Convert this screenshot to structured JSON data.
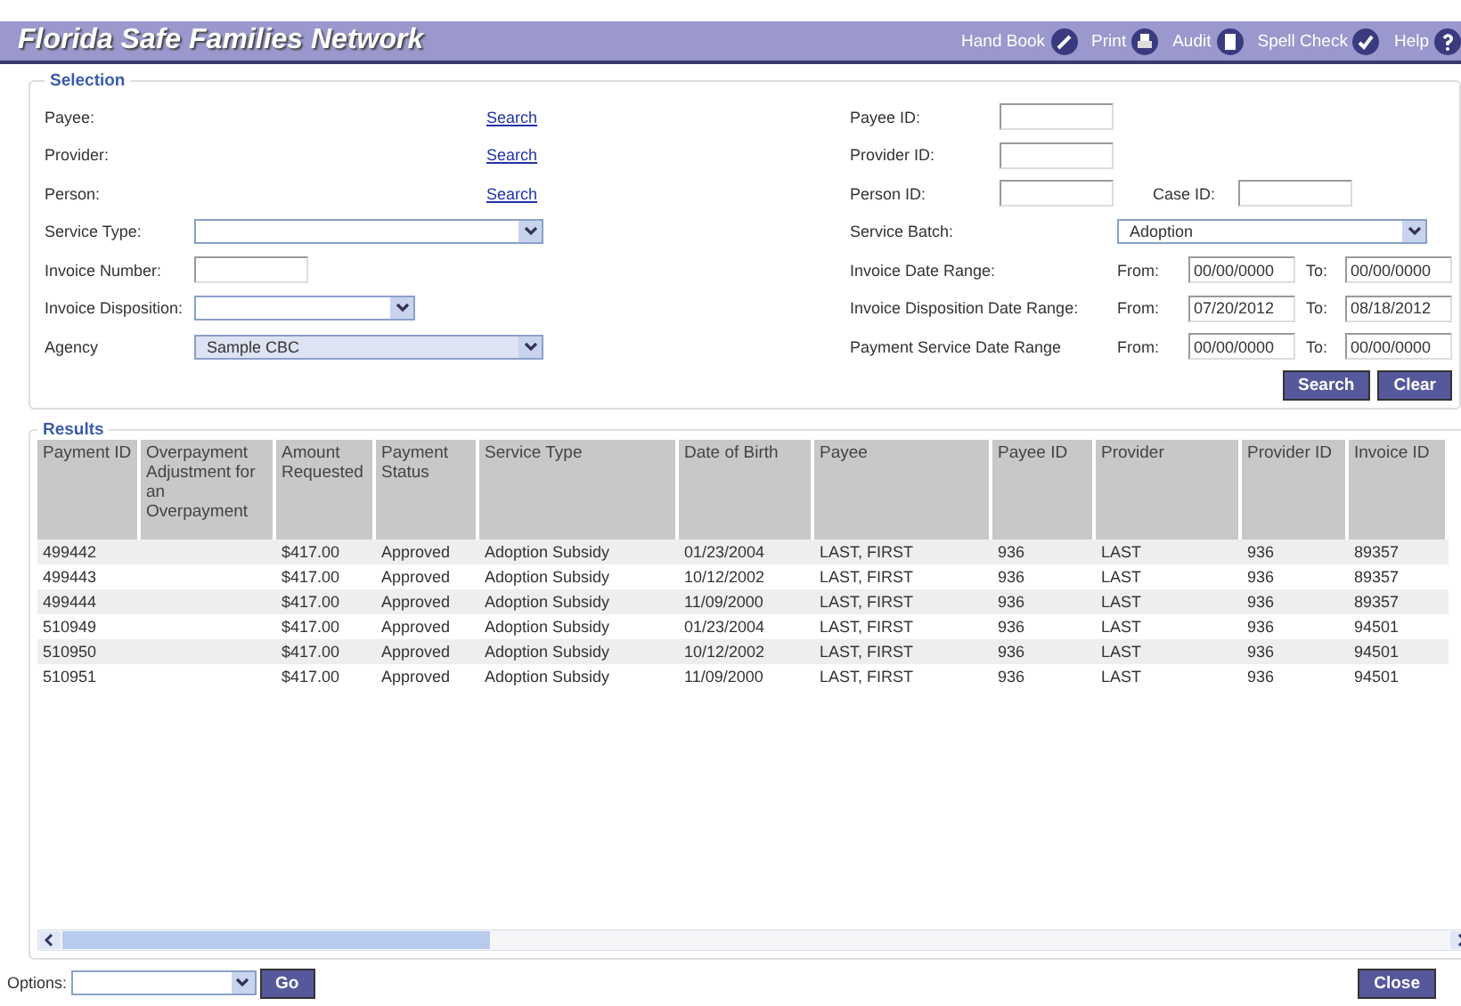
{
  "header": {
    "title": "Florida Safe Families Network",
    "tools": [
      {
        "label": "Hand Book",
        "kind": "handbook"
      },
      {
        "label": "Print",
        "kind": "print"
      },
      {
        "label": "Audit",
        "kind": "audit"
      },
      {
        "label": "Spell Check",
        "kind": "spellcheck"
      },
      {
        "label": "Help",
        "kind": "help"
      }
    ]
  },
  "selection": {
    "legend": "Selection",
    "left": [
      {
        "label": "Payee:",
        "kind": "link",
        "value": "Search"
      },
      {
        "label": "Provider:",
        "kind": "link",
        "value": "Search"
      },
      {
        "label": "Person:",
        "kind": "link",
        "value": "Search"
      },
      {
        "label": "Service Type:",
        "kind": "select"
      },
      {
        "label": "Invoice Number:",
        "kind": "input"
      },
      {
        "label": "Invoice Disposition:",
        "kind": "select"
      },
      {
        "label": "Agency",
        "kind": "select",
        "value": "Sample CBC"
      }
    ],
    "right": [
      {
        "label": "Payee ID:",
        "kind": "input"
      },
      {
        "label": "Provider ID:",
        "kind": "input"
      },
      {
        "label": "Person ID:",
        "kind": "input",
        "extra_label": "Case ID:"
      },
      {
        "label": "Service Batch:",
        "kind": "select",
        "value": "Adoption"
      },
      {
        "label": "Invoice Date Range:",
        "kind": "daterange",
        "from_label": "From:",
        "from": "00/00/0000",
        "to_label": "To:",
        "to": "00/00/0000"
      },
      {
        "label": "Invoice Disposition Date Range:",
        "kind": "daterange",
        "from_label": "From:",
        "from": "07/20/2012",
        "to_label": "To:",
        "to": "08/18/2012"
      },
      {
        "label": "Payment Service Date Range",
        "kind": "daterange",
        "from_label": "From:",
        "from": "00/00/0000",
        "to_label": "To:",
        "to": "00/00/0000"
      }
    ],
    "buttons": [
      "Search",
      "Clear"
    ]
  },
  "results": {
    "legend": "Results",
    "columns": [
      "Payment ID",
      "Overpayment Adjustment for an Overpayment",
      "Amount Requested",
      "Payment Status",
      "Service Type",
      "Date of Birth",
      "Payee",
      "Payee ID",
      "Provider",
      "Provider ID",
      "Invoice ID"
    ],
    "rows": [
      [
        "499442",
        "",
        "$417.00",
        "Approved",
        "Adoption Subsidy",
        "01/23/2004",
        "LAST, FIRST",
        "936",
        "LAST",
        "936",
        "89357"
      ],
      [
        "499443",
        "",
        "$417.00",
        "Approved",
        "Adoption Subsidy",
        "10/12/2002",
        "LAST, FIRST",
        "936",
        "LAST",
        "936",
        "89357"
      ],
      [
        "499444",
        "",
        "$417.00",
        "Approved",
        "Adoption Subsidy",
        "11/09/2000",
        "LAST, FIRST",
        "936",
        "LAST",
        "936",
        "89357"
      ],
      [
        "510949",
        "",
        "$417.00",
        "Approved",
        "Adoption Subsidy",
        "01/23/2004",
        "LAST, FIRST",
        "936",
        "LAST",
        "936",
        "94501"
      ],
      [
        "510950",
        "",
        "$417.00",
        "Approved",
        "Adoption Subsidy",
        "10/12/2002",
        "LAST, FIRST",
        "936",
        "LAST",
        "936",
        "94501"
      ],
      [
        "510951",
        "",
        "$417.00",
        "Approved",
        "Adoption Subsidy",
        "11/09/2000",
        "LAST, FIRST",
        "936",
        "LAST",
        "936",
        "94501"
      ]
    ]
  },
  "footer": {
    "options_label": "Options:",
    "go_button": "Go",
    "close_button": "Close"
  }
}
